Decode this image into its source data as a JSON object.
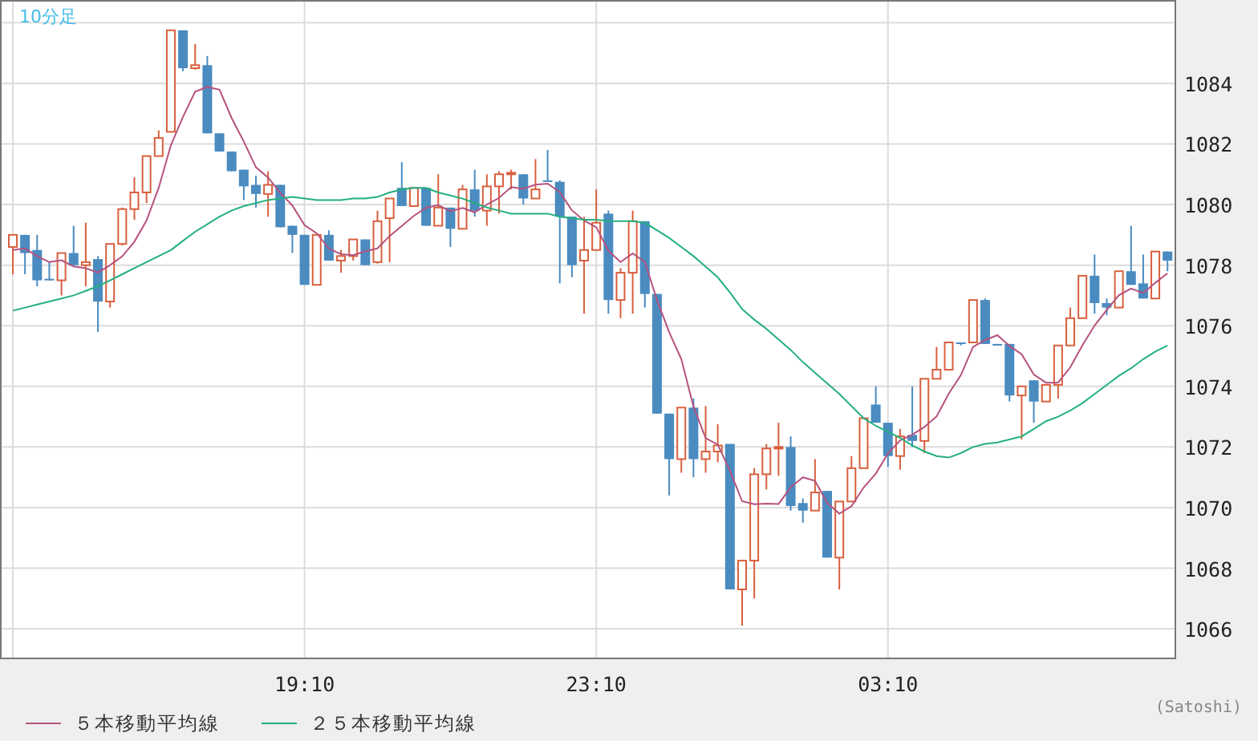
{
  "chart": {
    "chart_data": {
      "type": "candlestick",
      "title": "10分足",
      "grid": true,
      "categories": [
        null,
        null,
        null,
        null,
        null,
        null,
        null,
        null,
        null,
        null,
        null,
        null,
        null,
        null,
        null,
        null,
        null,
        null,
        null,
        null,
        null,
        null,
        null,
        null,
        "19:10",
        null,
        null,
        null,
        null,
        null,
        null,
        null,
        null,
        null,
        null,
        null,
        null,
        null,
        null,
        null,
        null,
        null,
        null,
        null,
        null,
        null,
        null,
        null,
        "23:10",
        null,
        null,
        null,
        null,
        null,
        null,
        null,
        null,
        null,
        null,
        null,
        null,
        null,
        null,
        null,
        null,
        null,
        null,
        null,
        null,
        null,
        null,
        null,
        "03:10",
        null,
        null,
        null,
        null,
        null,
        null,
        null,
        null,
        null,
        null,
        null,
        null,
        null,
        null,
        null,
        null,
        null,
        null,
        null,
        null,
        null,
        null,
        null
      ],
      "ylim": [
        1065.05,
        1086.75
      ],
      "yticks": [
        1066,
        1068,
        1070,
        1072,
        1074,
        1076,
        1078,
        1080,
        1082,
        1084
      ],
      "series": [
        {
          "name": "５本移動平均線",
          "type": "line",
          "color": "#b5527e",
          "values": [
            1078.5,
            1078.55,
            1078.3,
            1078.1,
            1078.16,
            1077.96,
            1077.9,
            1077.76,
            1078.0,
            1078.29,
            1078.77,
            1079.47,
            1080.55,
            1081.96,
            1082.89,
            1083.73,
            1083.88,
            1083.79,
            1082.86,
            1082.08,
            1081.23,
            1080.89,
            1080.39,
            1079.97,
            1079.32,
            1079.05,
            1078.55,
            1078.36,
            1078.33,
            1078.46,
            1078.55,
            1078.96,
            1079.29,
            1079.63,
            1079.89,
            1079.98,
            1079.78,
            1079.89,
            1079.74,
            1080.0,
            1080.22,
            1080.58,
            1080.52,
            1080.66,
            1080.69,
            1080.41,
            1079.81,
            1079.47,
            1079.25,
            1078.47,
            1078.1,
            1078.39,
            1078.1,
            1076.84,
            1075.79,
            1074.9,
            1073.33,
            1072.29,
            1072.08,
            1071.22,
            1070.21,
            1070.11,
            1070.13,
            1070.12,
            1070.67,
            1071.0,
            1070.88,
            1070.16,
            1069.8,
            1070.05,
            1070.66,
            1071.12,
            1071.79,
            1072.22,
            1072.4,
            1072.66,
            1073.01,
            1073.76,
            1074.37,
            1075.3,
            1075.53,
            1075.69,
            1075.34,
            1075.06,
            1074.39,
            1074.12,
            1074.12,
            1074.63,
            1075.36,
            1076.01,
            1076.52,
            1077.01,
            1077.23,
            1077.08,
            1077.42,
            1077.73
          ]
        },
        {
          "name": "２５本移動平均線",
          "type": "line",
          "color": "#23b07d",
          "values": [
            1076.5,
            1076.6,
            1076.7,
            1076.8,
            1076.9,
            1077.0,
            1077.15,
            1077.3,
            1077.5,
            1077.7,
            1077.9,
            1078.1,
            1078.3,
            1078.5,
            1078.8,
            1079.1,
            1079.35,
            1079.6,
            1079.8,
            1079.95,
            1080.05,
            1080.15,
            1080.2,
            1080.25,
            1080.2,
            1080.15,
            1080.15,
            1080.15,
            1080.2,
            1080.2,
            1080.25,
            1080.4,
            1080.5,
            1080.55,
            1080.55,
            1080.4,
            1080.3,
            1080.2,
            1080.05,
            1079.9,
            1079.8,
            1079.7,
            1079.7,
            1079.7,
            1079.7,
            1079.6,
            1079.55,
            1079.5,
            1079.5,
            1079.45,
            1079.45,
            1079.45,
            1079.4,
            1079.15,
            1078.9,
            1078.6,
            1078.3,
            1077.95,
            1077.6,
            1077.1,
            1076.55,
            1076.2,
            1075.9,
            1075.55,
            1075.2,
            1074.8,
            1074.45,
            1074.1,
            1073.75,
            1073.35,
            1072.95,
            1072.7,
            1072.5,
            1072.3,
            1072.05,
            1071.85,
            1071.7,
            1071.65,
            1071.8,
            1072.0,
            1072.1,
            1072.15,
            1072.25,
            1072.35,
            1072.6,
            1072.85,
            1073.0,
            1073.2,
            1073.45,
            1073.75,
            1074.05,
            1074.35,
            1074.6,
            1074.9,
            1075.15,
            1075.35
          ]
        }
      ],
      "ohlc": [
        [
          1078.6,
          1079.0,
          1077.7,
          1079.0
        ],
        [
          1079.0,
          1079.0,
          1077.7,
          1078.4
        ],
        [
          1078.5,
          1079.0,
          1077.3,
          1077.5
        ],
        [
          1077.55,
          1078.1,
          1077.5,
          1077.5
        ],
        [
          1077.5,
          1078.4,
          1077.0,
          1078.4
        ],
        [
          1078.4,
          1079.3,
          1078.0,
          1078.0
        ],
        [
          1078.0,
          1079.4,
          1077.3,
          1078.1
        ],
        [
          1078.2,
          1078.3,
          1075.8,
          1076.8
        ],
        [
          1076.8,
          1078.7,
          1076.6,
          1078.7
        ],
        [
          1078.7,
          1079.9,
          1078.65,
          1079.85
        ],
        [
          1079.85,
          1080.9,
          1079.5,
          1080.4
        ],
        [
          1080.4,
          1081.6,
          1080.05,
          1081.6
        ],
        [
          1081.6,
          1082.45,
          1081.6,
          1082.2
        ],
        [
          1082.4,
          1085.75,
          1082.4,
          1085.75
        ],
        [
          1085.75,
          1085.75,
          1084.4,
          1084.5
        ],
        [
          1084.5,
          1085.3,
          1084.45,
          1084.6
        ],
        [
          1084.6,
          1084.9,
          1082.35,
          1082.35
        ],
        [
          1082.35,
          1082.35,
          1081.75,
          1081.75
        ],
        [
          1081.75,
          1081.75,
          1081.1,
          1081.1
        ],
        [
          1081.15,
          1081.15,
          1080.15,
          1080.6
        ],
        [
          1080.65,
          1080.95,
          1079.9,
          1080.35
        ],
        [
          1080.35,
          1081.1,
          1079.6,
          1080.65
        ],
        [
          1080.65,
          1080.65,
          1079.25,
          1079.25
        ],
        [
          1079.3,
          1079.3,
          1078.4,
          1079.0
        ],
        [
          1079.0,
          1079.0,
          1077.35,
          1077.35
        ],
        [
          1077.35,
          1079.0,
          1077.35,
          1079.0
        ],
        [
          1079.0,
          1079.15,
          1078.15,
          1078.15
        ],
        [
          1078.15,
          1078.5,
          1077.75,
          1078.3
        ],
        [
          1078.3,
          1078.85,
          1078.15,
          1078.85
        ],
        [
          1078.85,
          1078.85,
          1078.0,
          1078.0
        ],
        [
          1078.1,
          1079.8,
          1078.05,
          1079.45
        ],
        [
          1079.55,
          1080.2,
          1078.1,
          1080.2
        ],
        [
          1080.55,
          1081.4,
          1079.95,
          1079.95
        ],
        [
          1079.95,
          1080.55,
          1079.95,
          1080.55
        ],
        [
          1080.55,
          1080.55,
          1079.3,
          1079.3
        ],
        [
          1079.3,
          1081.0,
          1079.3,
          1079.9
        ],
        [
          1079.9,
          1079.9,
          1078.6,
          1079.2
        ],
        [
          1079.2,
          1080.65,
          1079.2,
          1080.5
        ],
        [
          1080.5,
          1081.15,
          1079.6,
          1079.8
        ],
        [
          1079.8,
          1081.0,
          1079.3,
          1080.6
        ],
        [
          1080.6,
          1081.1,
          1079.7,
          1081.0
        ],
        [
          1081.0,
          1081.15,
          1080.5,
          1081.05
        ],
        [
          1081.0,
          1081.0,
          1080.0,
          1080.2
        ],
        [
          1080.2,
          1081.5,
          1080.2,
          1080.5
        ],
        [
          1080.8,
          1081.8,
          1080.75,
          1080.75
        ],
        [
          1080.75,
          1080.8,
          1077.4,
          1079.6
        ],
        [
          1079.6,
          1079.6,
          1077.6,
          1078.0
        ],
        [
          1078.15,
          1079.6,
          1076.4,
          1078.5
        ],
        [
          1078.5,
          1080.5,
          1078.5,
          1079.4
        ],
        [
          1079.7,
          1079.8,
          1076.4,
          1076.85
        ],
        [
          1076.85,
          1077.9,
          1076.25,
          1077.75
        ],
        [
          1077.75,
          1079.8,
          1076.4,
          1079.45
        ],
        [
          1079.45,
          1079.45,
          1076.6,
          1077.05
        ],
        [
          1077.05,
          1077.05,
          1073.1,
          1073.1
        ],
        [
          1073.1,
          1073.1,
          1070.4,
          1071.6
        ],
        [
          1071.6,
          1073.3,
          1071.15,
          1073.3
        ],
        [
          1073.3,
          1073.6,
          1071.0,
          1071.6
        ],
        [
          1071.6,
          1073.35,
          1071.15,
          1071.85
        ],
        [
          1071.85,
          1072.75,
          1071.5,
          1072.05
        ],
        [
          1072.1,
          1072.1,
          1067.3,
          1067.3
        ],
        [
          1067.3,
          1068.25,
          1066.1,
          1068.25
        ],
        [
          1068.25,
          1071.3,
          1067.0,
          1071.1
        ],
        [
          1071.1,
          1072.1,
          1070.6,
          1071.95
        ],
        [
          1071.95,
          1072.8,
          1071.05,
          1072.0
        ],
        [
          1072.0,
          1072.35,
          1069.9,
          1070.05
        ],
        [
          1070.15,
          1070.3,
          1069.5,
          1069.9
        ],
        [
          1069.9,
          1071.6,
          1069.9,
          1070.5
        ],
        [
          1070.55,
          1070.55,
          1068.35,
          1068.35
        ],
        [
          1068.35,
          1070.2,
          1067.3,
          1070.2
        ],
        [
          1070.2,
          1071.7,
          1070.2,
          1071.3
        ],
        [
          1071.3,
          1072.95,
          1071.3,
          1072.95
        ],
        [
          1073.4,
          1074.0,
          1072.8,
          1072.8
        ],
        [
          1072.8,
          1072.8,
          1071.35,
          1071.7
        ],
        [
          1071.7,
          1072.6,
          1071.25,
          1072.35
        ],
        [
          1072.4,
          1074.0,
          1072.0,
          1072.2
        ],
        [
          1072.2,
          1074.25,
          1071.8,
          1074.25
        ],
        [
          1074.25,
          1075.3,
          1074.25,
          1074.55
        ],
        [
          1074.55,
          1075.45,
          1074.55,
          1075.45
        ],
        [
          1075.45,
          1075.45,
          1075.35,
          1075.4
        ],
        [
          1075.45,
          1076.85,
          1075.45,
          1076.85
        ],
        [
          1076.85,
          1076.9,
          1075.4,
          1075.4
        ],
        [
          1075.4,
          1075.4,
          1075.35,
          1075.35
        ],
        [
          1075.4,
          1075.4,
          1073.5,
          1073.7
        ],
        [
          1073.7,
          1074.0,
          1072.25,
          1074.0
        ],
        [
          1074.2,
          1074.2,
          1072.8,
          1073.5
        ],
        [
          1073.5,
          1074.05,
          1073.5,
          1074.05
        ],
        [
          1074.05,
          1075.35,
          1073.6,
          1075.35
        ],
        [
          1075.35,
          1076.6,
          1075.35,
          1076.25
        ],
        [
          1076.25,
          1077.65,
          1076.25,
          1077.65
        ],
        [
          1077.65,
          1078.35,
          1076.4,
          1076.75
        ],
        [
          1076.75,
          1076.9,
          1076.35,
          1076.6
        ],
        [
          1076.6,
          1077.8,
          1076.6,
          1077.8
        ],
        [
          1077.8,
          1079.3,
          1077.35,
          1077.35
        ],
        [
          1077.4,
          1078.35,
          1076.9,
          1076.9
        ],
        [
          1076.9,
          1078.45,
          1076.9,
          1078.45
        ],
        [
          1078.45,
          1078.45,
          1077.8,
          1078.15
        ]
      ]
    }
  },
  "credit": "(Satoshi)"
}
